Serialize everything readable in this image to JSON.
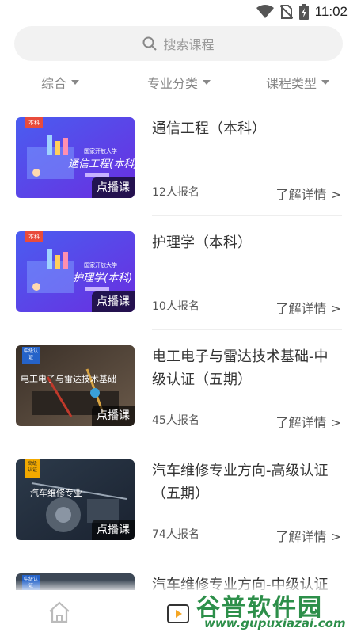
{
  "status_bar": {
    "time": "11:02",
    "icons": [
      "wifi-icon",
      "no-sim-icon",
      "battery-icon"
    ]
  },
  "search": {
    "placeholder": "搜索课程",
    "icon": "search-icon"
  },
  "filters": [
    {
      "label": "综合"
    },
    {
      "label": "专业分类"
    },
    {
      "label": "课程类型"
    }
  ],
  "courses": [
    {
      "title": "通信工程（本科）",
      "enrolled": "12人报名",
      "more": "了解详情 >",
      "tag": "点播课",
      "thumb_text": "通信工程(本科)",
      "thumb_header": "国家开放大学",
      "corner": "本科"
    },
    {
      "title": "护理学（本科）",
      "enrolled": "10人报名",
      "more": "了解详情 >",
      "tag": "点播课",
      "thumb_text": "护理学(本科)",
      "thumb_header": "国家开放大学",
      "corner": "本科"
    },
    {
      "title": "电工电子与雷达技术基础-中级认证（五期）",
      "enrolled": "45人报名",
      "more": "了解详情 >",
      "tag": "点播课",
      "thumb_text": "电工电子与雷达技术基础",
      "corner": "中级认证"
    },
    {
      "title": "汽车维修专业方向-高级认证（五期）",
      "enrolled": "74人报名",
      "more": "了解详情 >",
      "tag": "点播课",
      "thumb_text": "汽车维修专业",
      "corner": "高级认证"
    },
    {
      "title": "汽车维修专业方向-中级认证",
      "corner": "中级认证"
    }
  ],
  "watermark": {
    "brand": "谷普软件园",
    "url": "www.gupuxiazai.com"
  },
  "nav": {
    "items": [
      "home-icon",
      "course-play-icon"
    ]
  },
  "colors": {
    "accent": "#f5a623",
    "thumb_blue": "#3b4fe0",
    "watermark": "#2d8f4a"
  }
}
